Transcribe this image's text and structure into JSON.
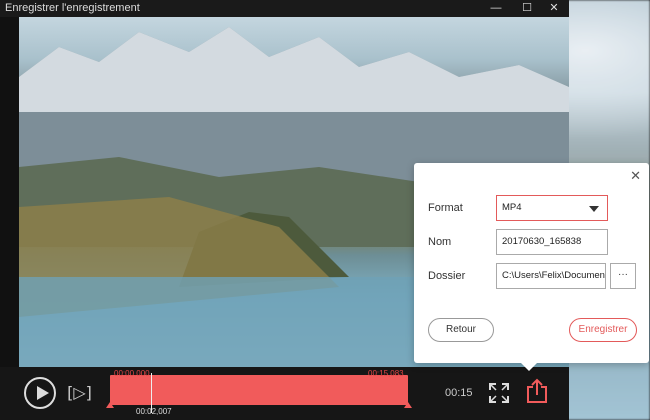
{
  "window": {
    "title": "Enregistrer l'enregistrement",
    "minimize_glyph": "—",
    "maximize_glyph": "☐",
    "close_glyph": "✕"
  },
  "player": {
    "time_start": "00:00.000",
    "time_end": "00:15,083",
    "time_current": "00:02,007",
    "duration": "00:15",
    "frame_step_glyph": "[▷]",
    "accent": "#f15b5b"
  },
  "save_dialog": {
    "close_glyph": "✕",
    "format_label": "Format",
    "format_value": "MP4",
    "name_label": "Nom",
    "name_value": "20170630_165838",
    "folder_label": "Dossier",
    "folder_value": "C:\\Users\\Felix\\Documents",
    "browse_label": "···",
    "back_button": "Retour",
    "save_button": "Enregistrer"
  }
}
